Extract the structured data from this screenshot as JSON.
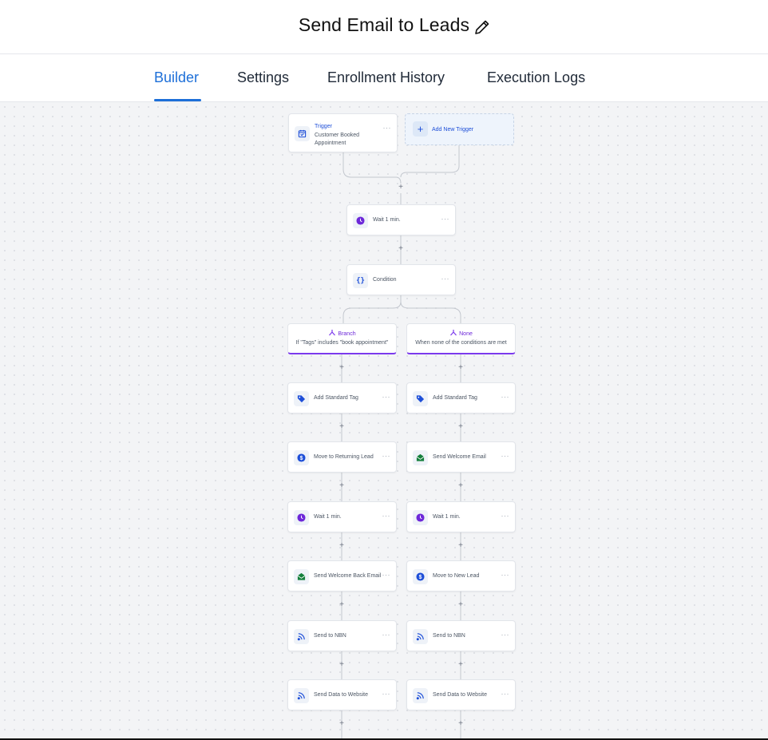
{
  "header": {
    "title": "Send Email to Leads",
    "edit_icon": "pencil-icon"
  },
  "tabs": [
    {
      "label": "Builder",
      "active": true
    },
    {
      "label": "Settings",
      "active": false
    },
    {
      "label": "Enrollment History",
      "active": false
    },
    {
      "label": "Execution Logs",
      "active": false
    }
  ],
  "colors": {
    "accent": "#1d6fd8",
    "branch": "#7c3aed",
    "wait": "#6d28d9",
    "email": "#15803d",
    "tag": "#1d4ed8"
  },
  "trigger": {
    "heading": "Trigger",
    "name": "Customer Booked Appointment",
    "icon": "calendar-check-icon",
    "menu": "···"
  },
  "add_trigger": {
    "label": "Add New Trigger",
    "icon": "plus-icon"
  },
  "steps": {
    "wait": {
      "label": "Wait 1 min.",
      "icon": "clock-icon"
    },
    "condition": {
      "label": "Condition",
      "icon": "braces-icon"
    }
  },
  "branches": [
    {
      "title": "Branch",
      "subtitle": "If \"Tags\" includes \"book appointment\"",
      "actions": [
        {
          "label": "Add Standard Tag",
          "icon": "tag-icon"
        },
        {
          "label": "Move to Returning Lead",
          "icon": "move-dollar-icon"
        },
        {
          "label": "Wait 1 min.",
          "icon": "clock-icon"
        },
        {
          "label": "Send Welcome Back Email",
          "icon": "email-icon"
        },
        {
          "label": "Send to NBN",
          "icon": "webhook-icon"
        },
        {
          "label": "Send Data to Website",
          "icon": "webhook-icon"
        }
      ]
    },
    {
      "title": "None",
      "subtitle": "When none of the conditions are met",
      "actions": [
        {
          "label": "Add Standard Tag",
          "icon": "tag-icon"
        },
        {
          "label": "Send Welcome Email",
          "icon": "email-icon"
        },
        {
          "label": "Wait 1 min.",
          "icon": "clock-icon"
        },
        {
          "label": "Move to New Lead",
          "icon": "move-dollar-icon"
        },
        {
          "label": "Send to NBN",
          "icon": "webhook-icon"
        },
        {
          "label": "Send Data to Website",
          "icon": "webhook-icon"
        }
      ]
    }
  ],
  "connector_add_symbol": "+",
  "node_menu_symbol": "···"
}
